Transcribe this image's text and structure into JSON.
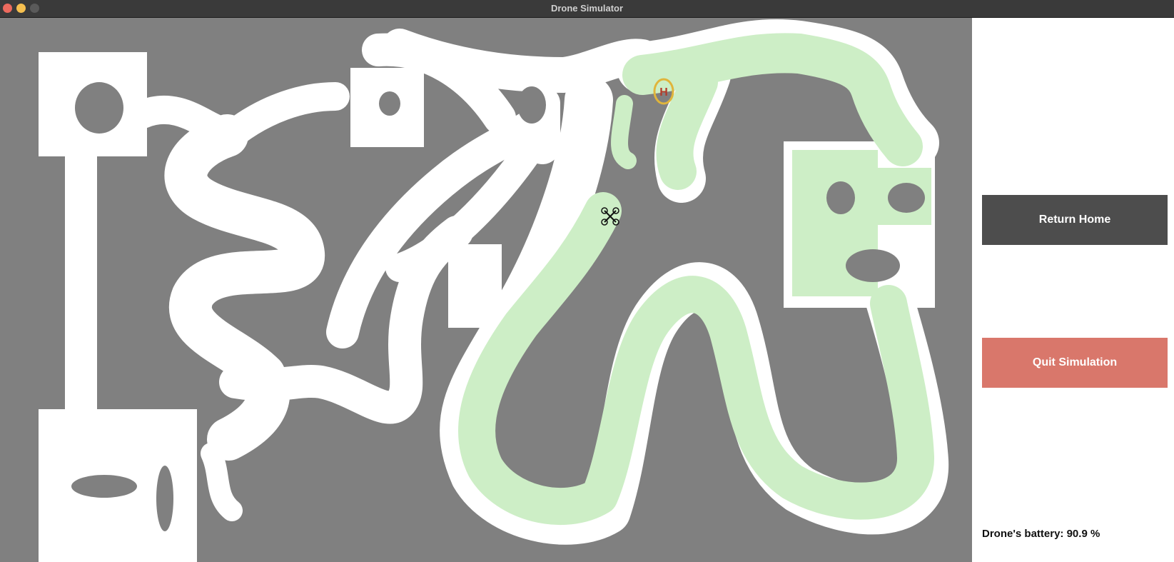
{
  "window": {
    "title": "Drone Simulator"
  },
  "simulation": {
    "colors": {
      "obstacle": "#808080",
      "free_space": "#ffffff",
      "explored": "#cdeec6",
      "home_marker": "#e0b53b",
      "home_letter": "#b33a2a"
    },
    "home_label": "H",
    "drone_icon": "quadcopter-icon"
  },
  "controls": {
    "return_home_label": "Return Home",
    "quit_label": "Quit Simulation",
    "return_home_color": "#4d4d4d",
    "quit_color": "#d9776b"
  },
  "status": {
    "battery_text": "Drone's battery: 90.9 %",
    "battery_percent": 90.9
  }
}
